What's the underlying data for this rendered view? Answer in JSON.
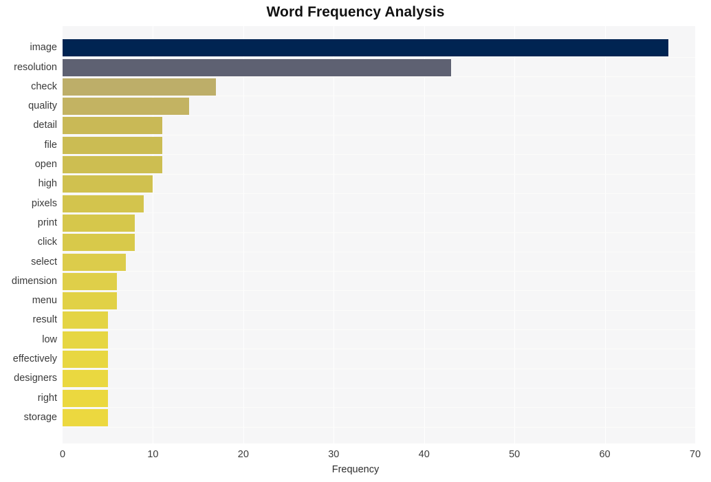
{
  "chart_data": {
    "type": "bar",
    "orientation": "horizontal",
    "title": "Word Frequency Analysis",
    "xlabel": "Frequency",
    "ylabel": "",
    "xlim": [
      0,
      70
    ],
    "xticks": [
      0,
      10,
      20,
      30,
      40,
      50,
      60,
      70
    ],
    "xtick_labels": [
      "0",
      "10",
      "20",
      "30",
      "40",
      "50",
      "60",
      "70"
    ],
    "grid": true,
    "legend": false,
    "categories": [
      "image",
      "resolution",
      "check",
      "quality",
      "detail",
      "file",
      "open",
      "high",
      "pixels",
      "print",
      "click",
      "select",
      "dimension",
      "menu",
      "result",
      "low",
      "effectively",
      "designers",
      "right",
      "storage"
    ],
    "values": [
      67,
      43,
      17,
      14,
      11,
      11,
      11,
      10,
      9,
      8,
      8,
      7,
      6,
      6,
      5,
      5,
      5,
      5,
      5,
      5
    ],
    "bar_colors": [
      "#002452",
      "#5e6172",
      "#bdae69",
      "#c3b362",
      "#c9b956",
      "#cbbc53",
      "#cdbe51",
      "#d0c14f",
      "#d3c44d",
      "#d6c74b",
      "#d8c94a",
      "#dccc4b",
      "#dfcf49",
      "#e1d146",
      "#e4d444",
      "#e6d642",
      "#e8d741",
      "#ead840",
      "#ebd83f",
      "#ecd83f"
    ],
    "plot_background": "#f6f6f7",
    "gridline_color": "#ffffff",
    "figure_background": "#ffffff"
  }
}
